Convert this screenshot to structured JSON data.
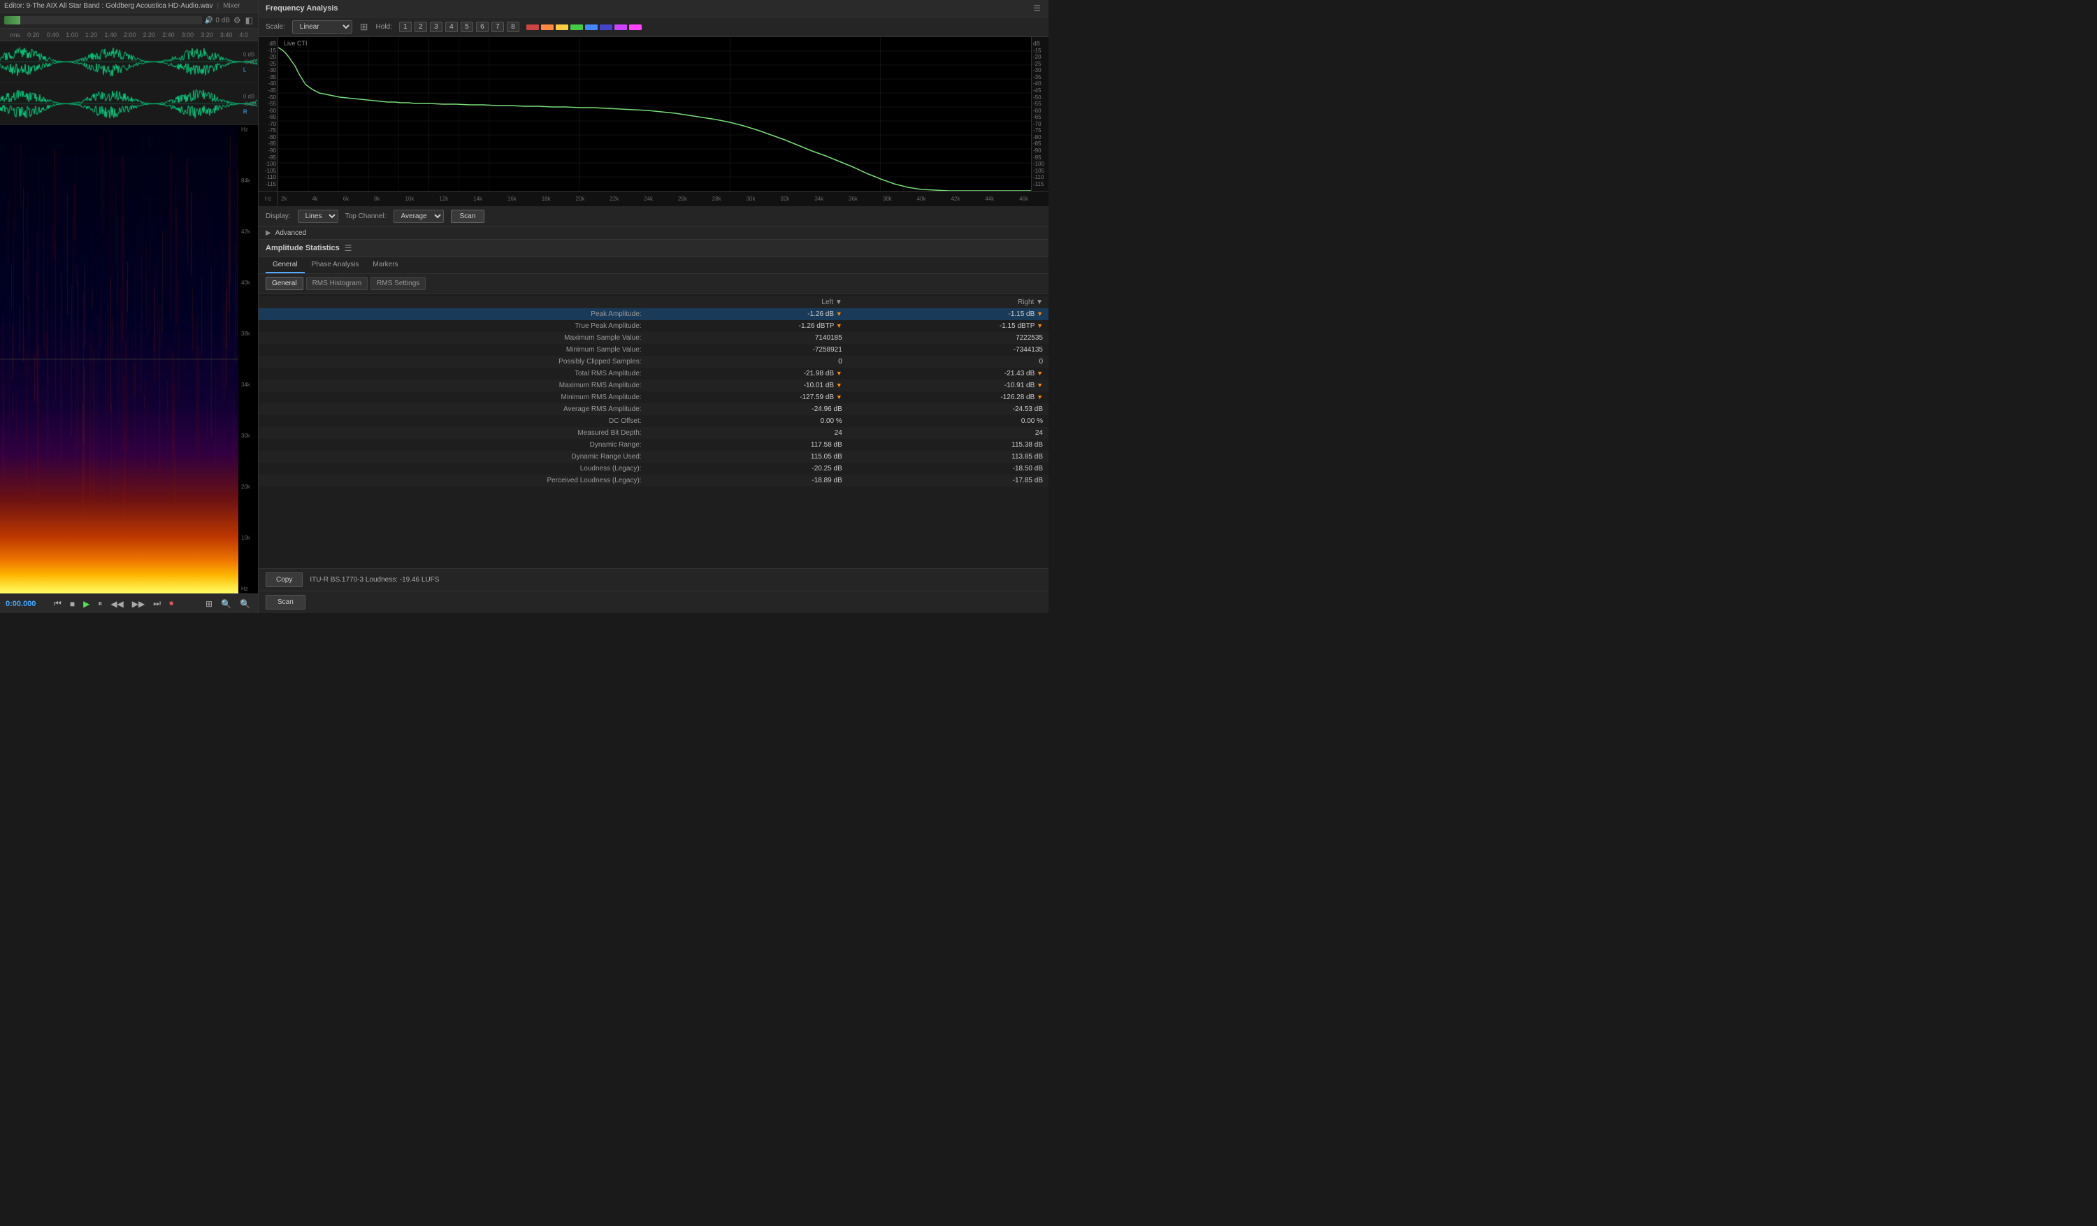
{
  "editor": {
    "title": "Editor: 9-The AIX All Star Band : Goldberg Acoustica HD-Audio.wav",
    "mixer": "Mixer",
    "time_display": "0:00.000",
    "gain_value": "0 dB"
  },
  "timeline": {
    "marks": [
      "rms",
      "0:20",
      "0:40",
      "1:00",
      "1:20",
      "1:40",
      "2:00",
      "2:20",
      "2:40",
      "3:00",
      "3:20",
      "3:40",
      "4:0"
    ]
  },
  "freq_analysis": {
    "title": "Frequency Analysis",
    "scale_label": "Scale:",
    "scale_value": "Linear",
    "hold_label": "Hold:",
    "hold_buttons": [
      "1",
      "2",
      "3",
      "4",
      "5",
      "6",
      "7",
      "8"
    ],
    "hold_colors": [
      "#c44",
      "#f84",
      "#fc4",
      "#4c4",
      "#48f",
      "#44c",
      "#c4f",
      "#f4f"
    ],
    "live_cti": "Live CTI",
    "display_label": "Display:",
    "display_value": "Lines",
    "top_channel_label": "Top Channel:",
    "top_channel_value": "Average",
    "scan_button": "Scan",
    "advanced_label": "Advanced",
    "freq_ticks": [
      "Hz",
      "2k",
      "4k",
      "6k",
      "8k",
      "10k",
      "12k",
      "14k",
      "16k",
      "18k",
      "20k",
      "22k",
      "24k",
      "26k",
      "28k",
      "30k",
      "32k",
      "34k",
      "36k",
      "38k",
      "40k",
      "42k",
      "44k",
      "46k"
    ],
    "db_ticks": [
      "dB",
      "-15",
      "-20",
      "-25",
      "-30",
      "-35",
      "-40",
      "-45",
      "-50",
      "-55",
      "-60",
      "-65",
      "-70",
      "-75",
      "-80",
      "-85",
      "-90",
      "-95",
      "-100",
      "-105",
      "-110",
      "-115"
    ],
    "left_axis_label": "Hz"
  },
  "amplitude_stats": {
    "title": "Amplitude Statistics",
    "tabs": [
      "Phase Analysis",
      "Markers"
    ],
    "active_tab": "General",
    "sub_tabs": [
      "General",
      "RMS Histogram",
      "RMS Settings"
    ],
    "columns": {
      "stat": "",
      "left": "Left",
      "right": "Right"
    },
    "rows": [
      {
        "label": "Peak Amplitude:",
        "left": "-1.26 dB",
        "right": "-1.15 dB",
        "highlight": true
      },
      {
        "label": "True Peak Amplitude:",
        "left": "-1.26 dBTP",
        "right": "-1.15 dBTP"
      },
      {
        "label": "Maximum Sample Value:",
        "left": "7140185",
        "right": "7222535"
      },
      {
        "label": "Minimum Sample Value:",
        "left": "-7258921",
        "right": "-7344135"
      },
      {
        "label": "Possibly Clipped Samples:",
        "left": "0",
        "right": "0"
      },
      {
        "label": "Total RMS Amplitude:",
        "left": "-21.98 dB",
        "right": "-21.43 dB"
      },
      {
        "label": "Maximum RMS Amplitude:",
        "left": "-10.01 dB",
        "right": "-10.91 dB"
      },
      {
        "label": "Minimum RMS Amplitude:",
        "left": "-127.59 dB",
        "right": "-126.28 dB"
      },
      {
        "label": "Average RMS Amplitude:",
        "left": "-24.96 dB",
        "right": "-24.53 dB"
      },
      {
        "label": "DC Offset:",
        "left": "0.00 %",
        "right": "0.00 %"
      },
      {
        "label": "Measured Bit Depth:",
        "left": "24",
        "right": "24"
      },
      {
        "label": "Dynamic Range:",
        "left": "117.58 dB",
        "right": "115.38 dB"
      },
      {
        "label": "Dynamic Range Used:",
        "left": "115.05 dB",
        "right": "113.85 dB"
      },
      {
        "label": "Loudness (Legacy):",
        "left": "-20.25 dB",
        "right": "-18.50 dB"
      },
      {
        "label": "Perceived Loudness (Legacy):",
        "left": "-18.89 dB",
        "right": "-17.85 dB"
      }
    ],
    "copy_button": "Copy",
    "scan_button": "Scan",
    "loudness_text": "ITU-R BS.1770-3 Loudness: -19.46 LUFS"
  },
  "transport": {
    "time": "0:00.000",
    "buttons": {
      "rewind": "⏮",
      "prev": "◀◀",
      "stop": "■",
      "play": "▶",
      "pause": "⏸",
      "next": "▶▶",
      "end": "⏭",
      "record": "⏺"
    }
  }
}
